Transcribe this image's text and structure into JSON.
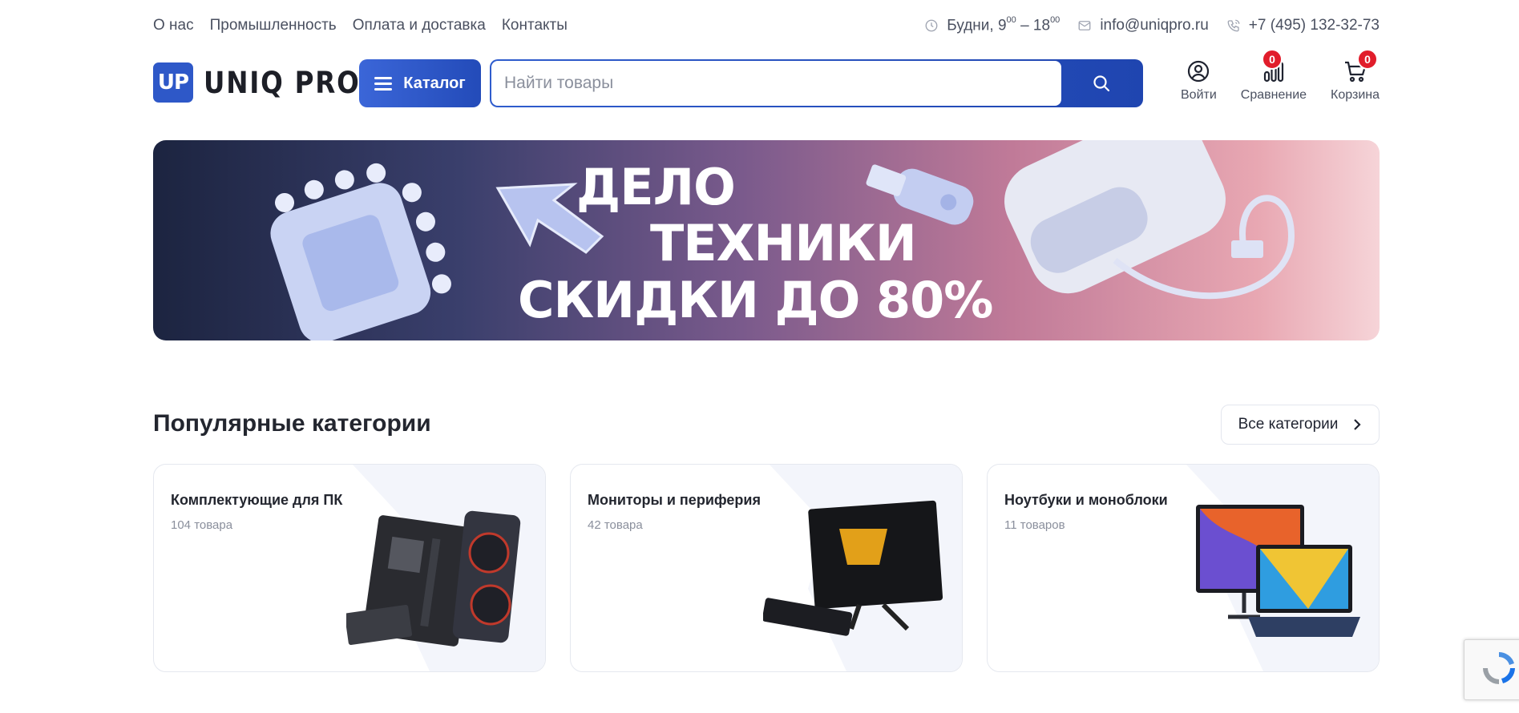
{
  "topnav": {
    "items": [
      "О нас",
      "Промышленность",
      "Оплата и доставка",
      "Контакты"
    ]
  },
  "contacts": {
    "hours_prefix": "Будни, 9",
    "hours_from_min": "00",
    "hours_sep": " – 18",
    "hours_to_min": "00",
    "email": "info@uniqpro.ru",
    "phone": "+7 (495) 132-32-73"
  },
  "logo": {
    "badge": "UP",
    "text": "UNIQ PRO"
  },
  "catalog": {
    "label": "Каталог"
  },
  "search": {
    "placeholder": "Найти товары",
    "value": ""
  },
  "actions": {
    "login": {
      "label": "Войти"
    },
    "compare": {
      "label": "Сравнение",
      "count": "0"
    },
    "cart": {
      "label": "Корзина",
      "count": "0"
    }
  },
  "banner": {
    "line1": "ДЕЛО",
    "line2": "ТЕХНИКИ",
    "line3": "СКИДКИ ДО 80%"
  },
  "section": {
    "title": "Популярные категории",
    "all_label": "Все категории"
  },
  "categories": [
    {
      "title": "Комплектующие для ПК",
      "count": "104 товара"
    },
    {
      "title": "Мониторы и периферия",
      "count": "42 товара"
    },
    {
      "title": "Ноутбуки и моноблоки",
      "count": "11 товаров"
    }
  ],
  "colors": {
    "accent": "#2e58c8",
    "badge": "#e11d2b"
  }
}
